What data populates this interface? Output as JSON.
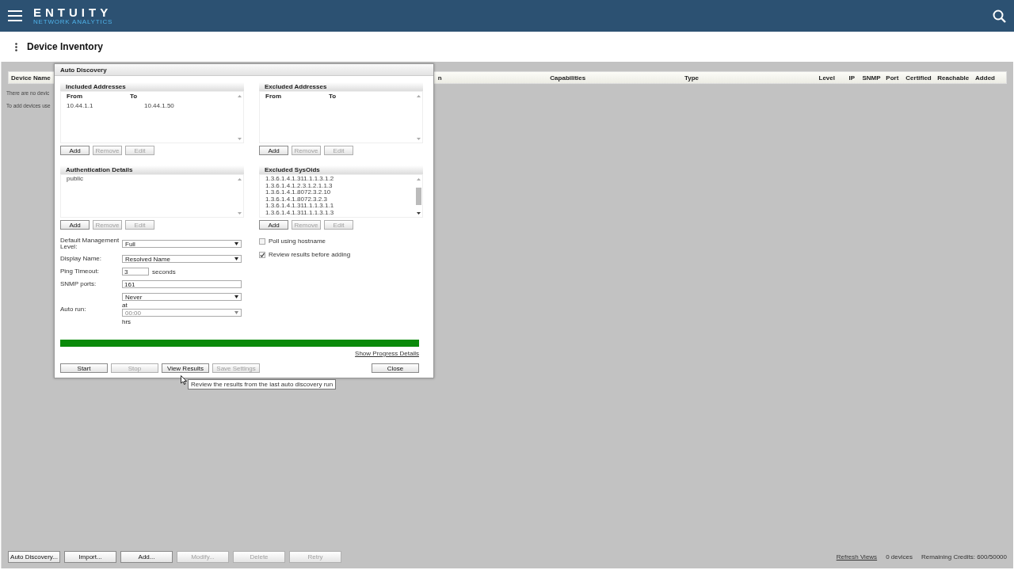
{
  "header": {
    "logo": "ENTUITY",
    "logo_subtitle": "NETWORK ANALYTICS"
  },
  "page_title": "Device Inventory",
  "table": {
    "columns": [
      {
        "label": "Device Name"
      },
      {
        "label": "n"
      },
      {
        "label": "Capabilities"
      },
      {
        "label": "Type"
      },
      {
        "label": "Level"
      },
      {
        "label": "IP"
      },
      {
        "label": "SNMP"
      },
      {
        "label": "Port"
      },
      {
        "label": "Certified"
      },
      {
        "label": "Reachable"
      },
      {
        "label": "Added"
      }
    ],
    "empty_messages": [
      "There are no devic",
      "To add devices use"
    ]
  },
  "dialog": {
    "title": "Auto Discovery",
    "sections": [
      {
        "kind": "table",
        "title": "Included Addresses",
        "columns": [
          "From",
          "To"
        ],
        "rows": [
          [
            "10.44.1.1",
            "10.44.1.50"
          ]
        ],
        "buttons": [
          {
            "label": "Add",
            "disabled": false
          },
          {
            "label": "Remove",
            "disabled": true
          },
          {
            "label": "Edit",
            "disabled": true
          }
        ]
      },
      {
        "kind": "table",
        "title": "Excluded Addresses",
        "columns": [
          "From",
          "To"
        ],
        "buttons": [
          {
            "label": "Add",
            "disabled": false
          },
          {
            "label": "Remove",
            "disabled": true
          },
          {
            "label": "Edit",
            "disabled": true
          }
        ]
      },
      {
        "kind": "list",
        "title": "Authentication Details",
        "items": [
          "public"
        ],
        "buttons": [
          {
            "label": "Add",
            "disabled": false
          },
          {
            "label": "Remove",
            "disabled": true
          },
          {
            "label": "Edit",
            "disabled": true
          }
        ]
      },
      {
        "kind": "list",
        "title": "Excluded SysOids",
        "items": [
          "1.3.6.1.4.1.311.1.1.3.1.2",
          "1.3.6.1.4.1.2.3.1.2.1.1.3",
          "1.3.6.1.4.1.8072.3.2.10",
          "1.3.6.1.4.1.8072.3.2.3",
          "1.3.6.1.4.1.311.1.1.3.1.1",
          "1.3.6.1.4.1.311.1.1.3.1.3"
        ],
        "buttons": [
          {
            "label": "Add",
            "disabled": false
          },
          {
            "label": "Remove",
            "disabled": true
          },
          {
            "label": "Edit",
            "disabled": true
          }
        ]
      }
    ],
    "fields": [
      {
        "kind": "select",
        "label": "Default Management Level:",
        "value": "Full"
      },
      {
        "kind": "select",
        "label": "Display Name:",
        "value": "Resolved Name"
      },
      {
        "kind": "short_input",
        "label": "Ping Timeout:",
        "value": "3",
        "unit": "seconds"
      },
      {
        "kind": "input",
        "label": "SNMP ports:",
        "value": "161"
      },
      {
        "kind": "schedule",
        "label": "Auto run:",
        "value": "Never",
        "at_label": "at",
        "time": "00:00",
        "time_disabled": true,
        "unit": "hrs"
      }
    ],
    "checkboxes": [
      {
        "label": "Poll using hostname",
        "checked": false
      },
      {
        "label": "Review results before adding",
        "checked": true
      }
    ],
    "progress": {
      "level": 1
    },
    "progress_link": "Show Progress Details",
    "buttons": [
      {
        "label": "Start",
        "disabled": false
      },
      {
        "label": "Stop",
        "disabled": true
      },
      {
        "label": "View Results",
        "disabled": false
      },
      {
        "label": "Save Settings",
        "disabled": true
      }
    ],
    "close_button": "Close",
    "tooltip": "Review the results from the last auto discovery run"
  },
  "toolbar": {
    "buttons": [
      {
        "label": "Auto Discovery...",
        "disabled": false
      },
      {
        "label": "Import...",
        "disabled": false
      },
      {
        "label": "Add...",
        "disabled": false
      },
      {
        "label": "Modify...",
        "disabled": true
      },
      {
        "label": "Delete",
        "disabled": true
      },
      {
        "label": "Retry",
        "disabled": true
      }
    ],
    "refresh_link": "Refresh Views",
    "device_count": "0 devices",
    "credits": "Remaining Credits: 600/50000"
  }
}
